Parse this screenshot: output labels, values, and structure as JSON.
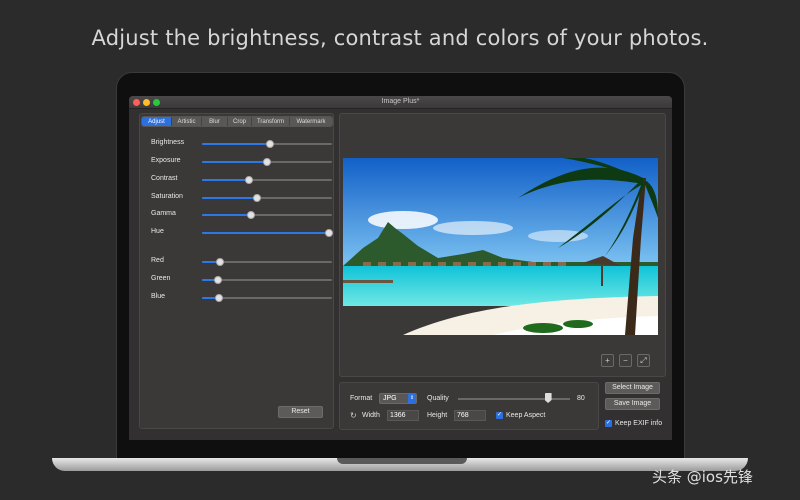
{
  "headline": "Adjust the brightness, contrast and colors of your photos.",
  "window": {
    "title": "Image Plus*"
  },
  "tabs": [
    "Adjust",
    "Artistic",
    "Blur",
    "Crop",
    "Transform",
    "Watermark"
  ],
  "active_tab": "Adjust",
  "sliders": [
    {
      "label": "Brightness",
      "fraction": 0.52
    },
    {
      "label": "Exposure",
      "fraction": 0.5
    },
    {
      "label": "Contrast",
      "fraction": 0.36
    },
    {
      "label": "Saturation",
      "fraction": 0.42
    },
    {
      "label": "Gamma",
      "fraction": 0.38
    },
    {
      "label": "Hue",
      "fraction": 0.98
    },
    {
      "label": "Red",
      "fraction": 0.14
    },
    {
      "label": "Green",
      "fraction": 0.12
    },
    {
      "label": "Blue",
      "fraction": 0.13
    }
  ],
  "buttons": {
    "reset": "Reset",
    "select_image": "Select Image",
    "save_image": "Save Image"
  },
  "zoom": {
    "plus": "+",
    "minus": "−",
    "fit": "⤢"
  },
  "output": {
    "format_label": "Format",
    "format_value": "JPG",
    "quality_label": "Quality",
    "quality_value": "80",
    "quality_fraction": 0.8,
    "width_label": "Width",
    "width_value": "1366",
    "height_label": "Height",
    "height_value": "768",
    "keep_aspect_label": "Keep Aspect",
    "keep_exif_label": "Keep EXIF info"
  },
  "watermark_text": "头条 @ios先锋",
  "colors": {
    "accent": "#2f76e8",
    "background": "#2b2b2b",
    "panel": "#3b3938"
  }
}
